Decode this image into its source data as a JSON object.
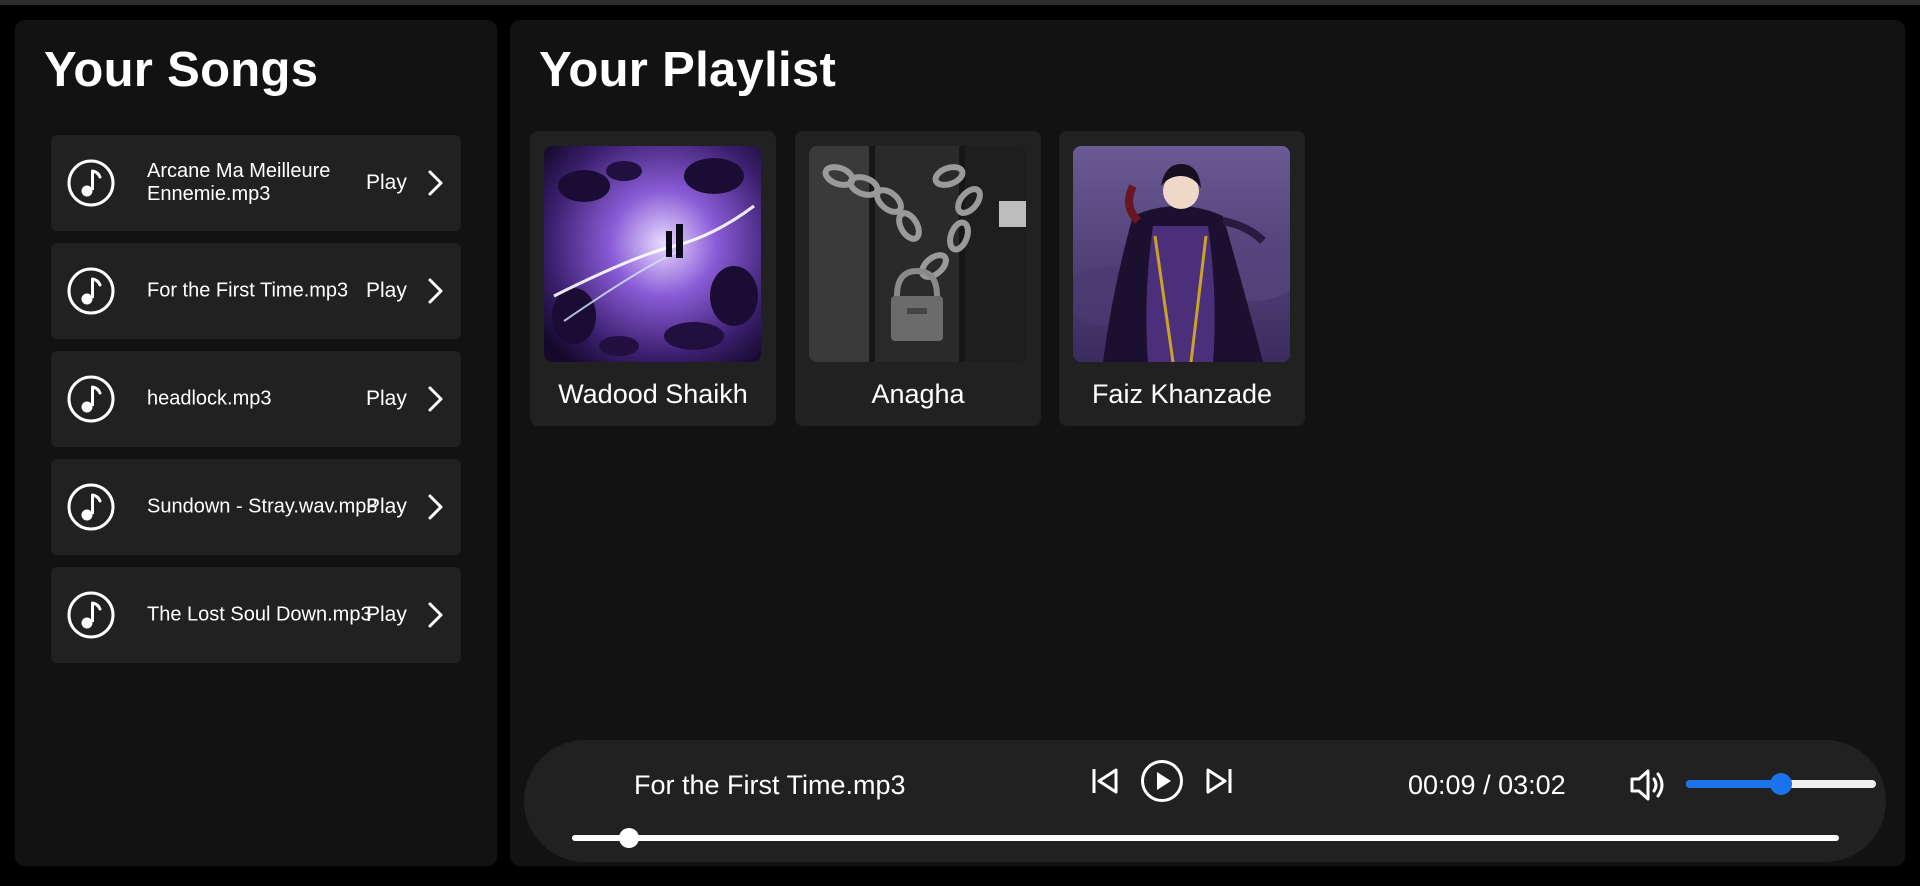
{
  "songs_panel": {
    "title": "Your Songs",
    "items": [
      {
        "name": "Arcane Ma Meilleure Ennemie.mp3",
        "action": "Play"
      },
      {
        "name": "For the First Time.mp3",
        "action": "Play"
      },
      {
        "name": "headlock.mp3",
        "action": "Play"
      },
      {
        "name": "Sundown - Stray.wav.mp3",
        "action": "Play"
      },
      {
        "name": "The Lost Soul Down.mp3",
        "action": "Play"
      }
    ],
    "icons": {
      "song": "music-note-icon",
      "open": "chevron-right-icon"
    }
  },
  "playlist_panel": {
    "title": "Your Playlist",
    "cards": [
      {
        "name": "Wadood Shaikh",
        "art": "purple-fractal-art"
      },
      {
        "name": "Anagha",
        "art": "chained-lock-art"
      },
      {
        "name": "Faiz Khanzade",
        "art": "caped-character-art"
      }
    ]
  },
  "player": {
    "now_playing": "For the First Time.mp3",
    "time_readout": "00:09 / 03:02",
    "progress_fraction": 0.045,
    "volume_fraction": 0.5,
    "icons": {
      "previous": "skip-previous-icon",
      "play": "play-circle-icon",
      "next": "skip-next-icon",
      "volume": "volume-icon"
    }
  },
  "colors": {
    "background": "#000000",
    "panel": "#121212",
    "item": "#212121",
    "accent": "#1a73e8",
    "text": "#ffffff"
  }
}
